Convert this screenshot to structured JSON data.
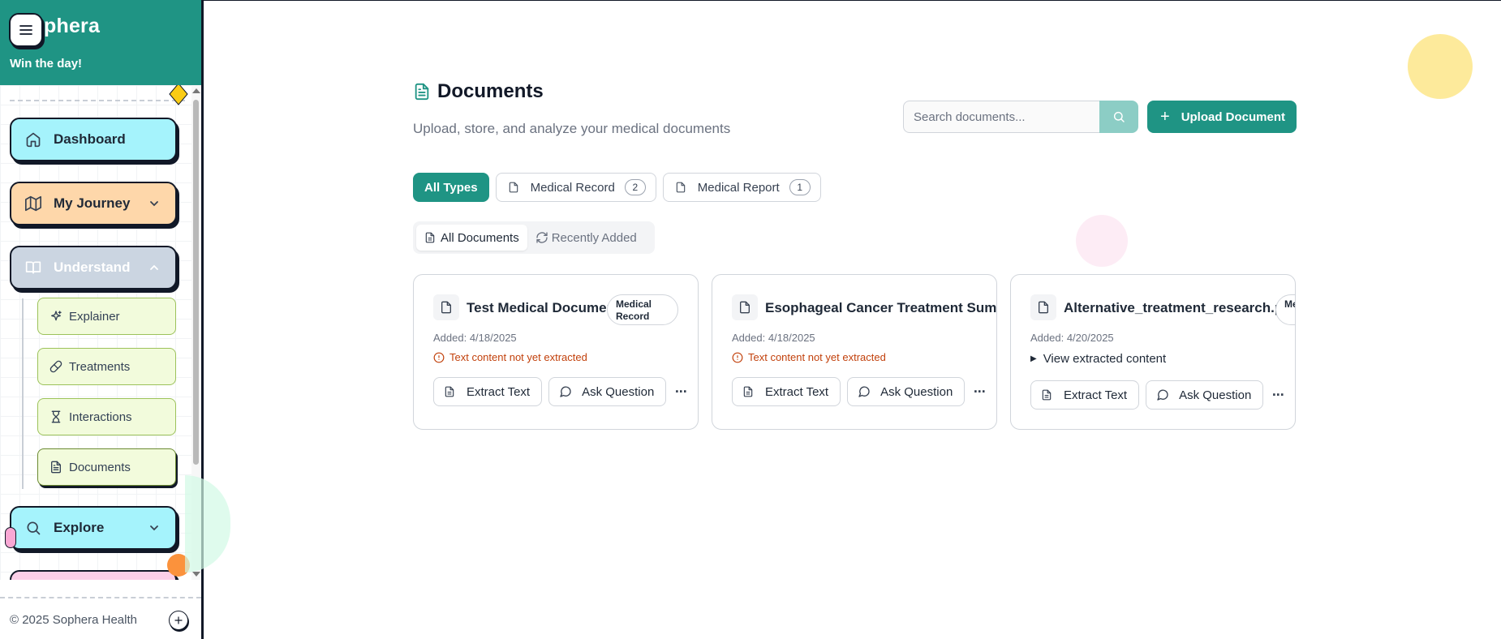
{
  "sidebar": {
    "title": "Sophera",
    "title_visible": "phera",
    "tagline": "Win the day!",
    "nav": [
      {
        "label": "Dashboard",
        "icon": "home-icon",
        "color": "#a5f3fc"
      },
      {
        "label": "My Journey",
        "icon": "map-icon",
        "color": "#fed7aa"
      },
      {
        "label": "Understand",
        "icon": "book-open-icon",
        "color": "#cbd5e1"
      },
      {
        "label": "Explore",
        "icon": "search-icon",
        "color": "#a5f3fc"
      }
    ],
    "sub_items": [
      {
        "label": "Explainer",
        "icon": "sparkles-icon"
      },
      {
        "label": "Treatments",
        "icon": "pill-icon"
      },
      {
        "label": "Interactions",
        "icon": "hourglass-icon"
      },
      {
        "label": "Documents",
        "icon": "file-text-icon"
      }
    ],
    "footer": "© 2025 Sophera Health"
  },
  "header": {
    "title": "Documents",
    "subtitle": "Upload, store, and analyze your medical documents"
  },
  "search": {
    "placeholder": "Search documents..."
  },
  "upload_label": "Upload Document",
  "filters": [
    {
      "label": "All Types",
      "active": true
    },
    {
      "label": "Medical Record",
      "count": "2"
    },
    {
      "label": "Medical Report",
      "count": "1"
    }
  ],
  "tabs": [
    {
      "label": "All Documents",
      "active": true
    },
    {
      "label": "Recently Added"
    }
  ],
  "documents": [
    {
      "title": "Test Medical Document",
      "badge": "Medical Record",
      "date": "Added: 4/18/2025",
      "status": "Text content not yet extracted",
      "extract_label": "Extract Text",
      "ask_label": "Ask Question",
      "more": "···"
    },
    {
      "title": "Esophageal Cancer Treatment Summar",
      "badge": "",
      "date": "Added: 4/18/2025",
      "status": "Text content not yet extracted",
      "extract_label": "Extract Text",
      "ask_label": "Ask Question",
      "more": "···"
    },
    {
      "title": "Alternative_treatment_research.pdf",
      "badge": "Me Re",
      "date": "Added: 4/20/2025",
      "details": "View extracted content",
      "extract_label": "Extract Text",
      "ask_label": "Ask Question",
      "more": "···"
    }
  ],
  "colors": {
    "brand": "#1f9484",
    "warning": "#c2410c"
  }
}
